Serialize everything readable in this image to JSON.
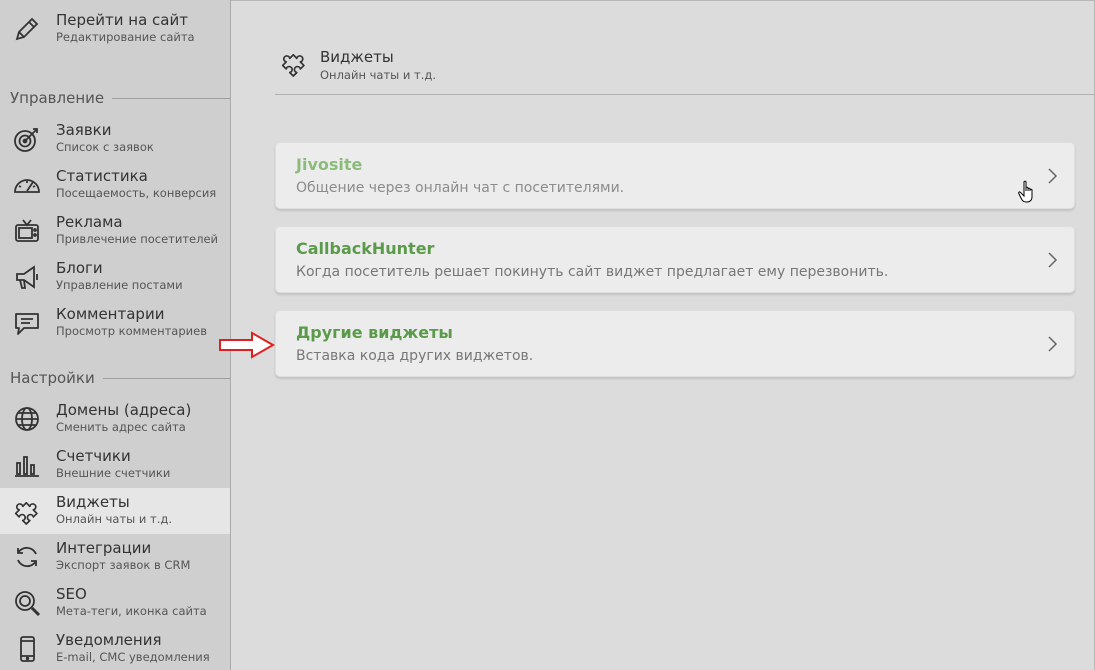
{
  "sidebar": {
    "top": {
      "title": "Перейти на сайт",
      "subtitle": "Редактирование сайта",
      "icon": "pencil-icon"
    },
    "sections": {
      "management": "Управление",
      "settings": "Настройки"
    },
    "management_items": [
      {
        "title": "Заявки",
        "subtitle": "Список с заявок",
        "icon": "target-icon"
      },
      {
        "title": "Статистика",
        "subtitle": "Посещаемость, конверсия",
        "icon": "speedometer-icon"
      },
      {
        "title": "Реклама",
        "subtitle": "Привлечение посетителей",
        "icon": "tv-icon"
      },
      {
        "title": "Блоги",
        "subtitle": "Управление постами",
        "icon": "megaphone-icon"
      },
      {
        "title": "Комментарии",
        "subtitle": "Просмотр комментариев",
        "icon": "comment-icon"
      }
    ],
    "settings_items": [
      {
        "title": "Домены (адреса)",
        "subtitle": "Сменить адрес сайта",
        "icon": "globe-icon"
      },
      {
        "title": "Счетчики",
        "subtitle": "Внешние счетчики",
        "icon": "bar-chart-icon"
      },
      {
        "title": "Виджеты",
        "subtitle": "Онлайн чаты и т.д.",
        "icon": "puzzle-icon",
        "active": true
      },
      {
        "title": "Интеграции",
        "subtitle": "Экспорт заявок в CRM",
        "icon": "sync-icon"
      },
      {
        "title": "SEO",
        "subtitle": "Мета-теги, иконка сайта",
        "icon": "search-icon"
      },
      {
        "title": "Уведомления",
        "subtitle": "E-mail, СМС уведомления",
        "icon": "phone-icon"
      }
    ]
  },
  "main": {
    "header": {
      "title": "Виджеты",
      "subtitle": "Онлайн чаты и т.д.",
      "icon": "puzzle-icon"
    },
    "cards": [
      {
        "title": "Jivosite",
        "description": "Общение через онлайн чат с посетителями.",
        "faded": true
      },
      {
        "title": "CallbackHunter",
        "description": "Когда посетитель решает покинуть сайт виджет предлагает ему перезвонить."
      },
      {
        "title": "Другие виджеты",
        "description": "Вставка кода других виджетов."
      }
    ]
  },
  "colors": {
    "accent": "#5a9a4a",
    "arrow": "#e02020"
  }
}
